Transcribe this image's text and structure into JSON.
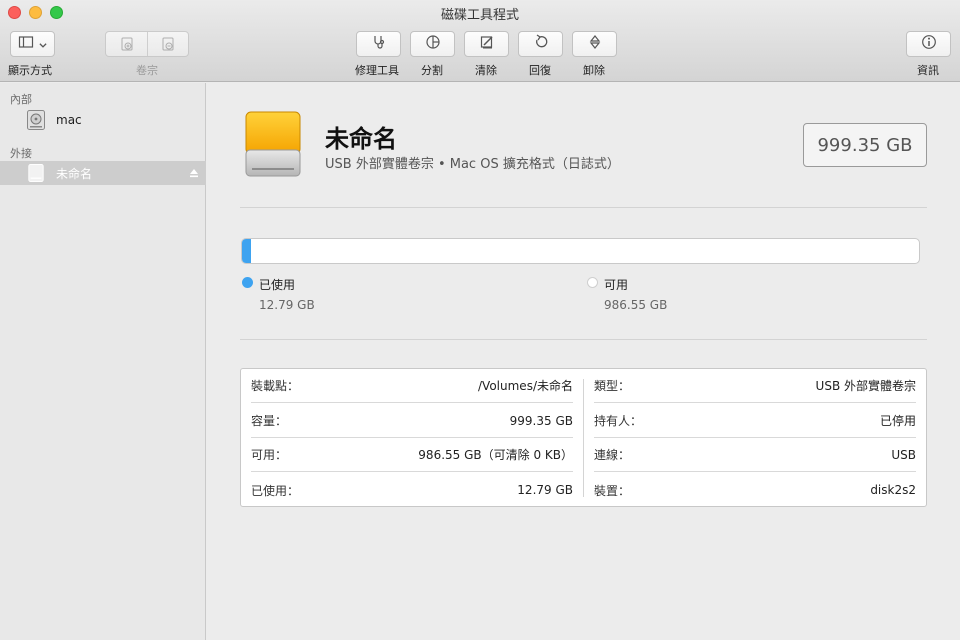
{
  "window": {
    "title": "磁碟工具程式"
  },
  "toolbar": {
    "view_label": "顯示方式",
    "volume_label": "卷宗",
    "first_aid_label": "修理工具",
    "partition_label": "分割",
    "erase_label": "清除",
    "restore_label": "回復",
    "unmount_label": "卸除",
    "info_label": "資訊"
  },
  "sidebar": {
    "internal_header": "內部",
    "internal_items": [
      {
        "label": "mac",
        "icon": "internal-disk-icon"
      }
    ],
    "external_header": "外接",
    "external_items": [
      {
        "label": "未命名",
        "icon": "external-disk-icon",
        "selected": true
      }
    ]
  },
  "volume": {
    "name": "未命名",
    "description": "USB 外部實體卷宗 • Mac OS 擴充格式（日誌式）",
    "capacity": "999.35 GB"
  },
  "usage": {
    "used_fraction": 0.0128,
    "used_label": "已使用",
    "used_value": "12.79 GB",
    "free_label": "可用",
    "free_value": "986.55 GB",
    "used_color": "#3ea3f0"
  },
  "info": {
    "left": [
      {
        "key": "裝載點：",
        "value": "/Volumes/未命名"
      },
      {
        "key": "容量：",
        "value": "999.35 GB"
      },
      {
        "key": "可用：",
        "value": "986.55 GB（可清除 0 KB）"
      },
      {
        "key": "已使用：",
        "value": "12.79 GB"
      }
    ],
    "right": [
      {
        "key": "類型：",
        "value": "USB 外部實體卷宗"
      },
      {
        "key": "持有人：",
        "value": "已停用"
      },
      {
        "key": "連線：",
        "value": "USB"
      },
      {
        "key": "裝置：",
        "value": "disk2s2"
      }
    ]
  }
}
